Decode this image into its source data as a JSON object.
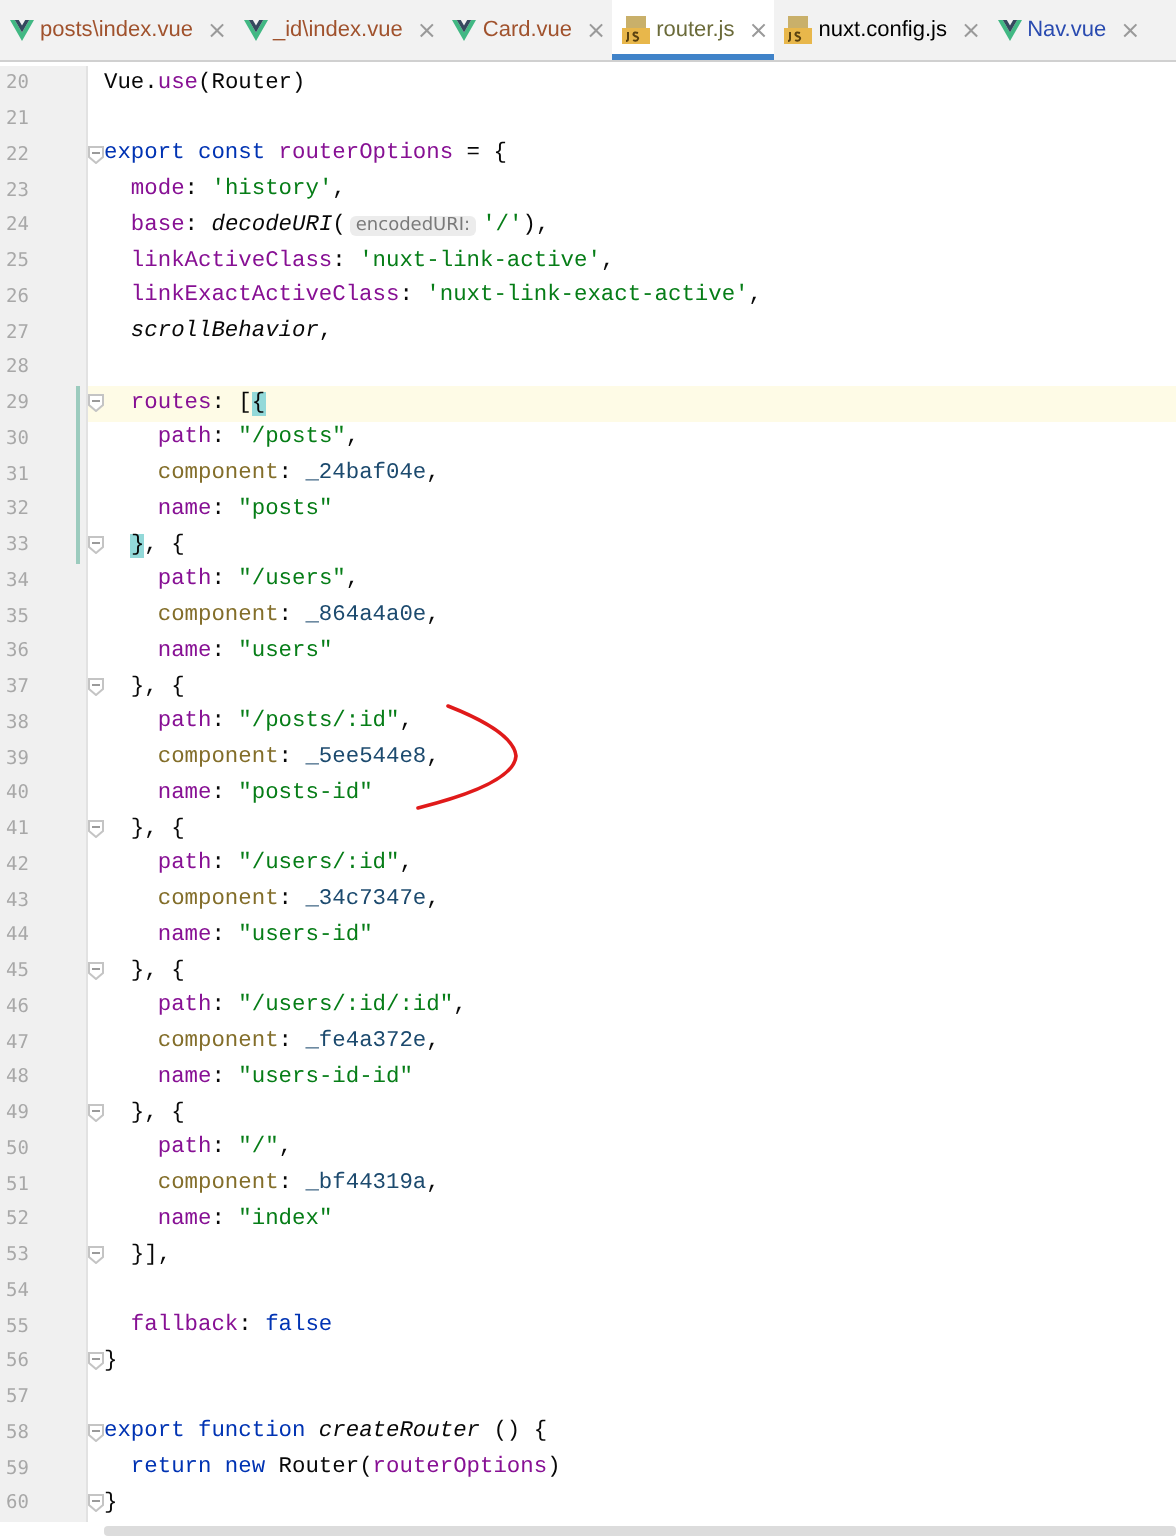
{
  "tabs": [
    {
      "label": "posts\\index.vue",
      "kind": "vue",
      "color": "#a0522d",
      "selected": false,
      "close": "×"
    },
    {
      "label": "_id\\index.vue",
      "kind": "vue",
      "color": "#a0522d",
      "selected": false,
      "close": "×"
    },
    {
      "label": "Card.vue",
      "kind": "vue",
      "color": "#a0522d",
      "selected": false,
      "close": "×"
    },
    {
      "label": "router.js",
      "kind": "js",
      "color": "#6b6b3a",
      "selected": true,
      "close": "×"
    },
    {
      "label": "nuxt.config.js",
      "kind": "js",
      "color": "#000000",
      "selected": false,
      "close": "×"
    },
    {
      "label": "Nav.vue",
      "kind": "vue",
      "color": "#2a4bb0",
      "selected": false,
      "close": "×"
    }
  ],
  "editor": {
    "lines": [
      {
        "number": "20",
        "fold": false,
        "changed": false,
        "current": false,
        "tokens": [
          {
            "text": "Vue.",
            "kind": "plain"
          },
          {
            "text": "use",
            "kind": "prop"
          },
          {
            "text": "(Router)",
            "kind": "plain"
          }
        ]
      },
      {
        "number": "21",
        "fold": false,
        "changed": false,
        "current": false
      },
      {
        "number": "22",
        "fold": true,
        "changed": false,
        "current": false,
        "tokens": [
          {
            "text": "export const",
            "kind": "keyword"
          },
          {
            "text": " routerOptions",
            "kind": "prop"
          },
          {
            "text": " = {",
            "kind": "plain"
          }
        ]
      },
      {
        "number": "23",
        "fold": false,
        "changed": false,
        "current": false,
        "tokens": [
          {
            "text": "  mode",
            "kind": "prop"
          },
          {
            "text": ": ",
            "kind": "plain"
          },
          {
            "text": "'history'",
            "kind": "string"
          },
          {
            "text": ",",
            "kind": "plain"
          }
        ]
      },
      {
        "number": "24",
        "fold": false,
        "changed": false,
        "current": false,
        "tokens": [
          {
            "text": "  base",
            "kind": "prop"
          },
          {
            "text": ": ",
            "kind": "plain"
          },
          {
            "text": "decodeURI",
            "kind": "italic"
          },
          {
            "text": "(",
            "kind": "plain"
          },
          {
            "text": "encodedURI:",
            "kind": "hint"
          },
          {
            "text": "'/'",
            "kind": "string"
          },
          {
            "text": "),",
            "kind": "plain"
          }
        ]
      },
      {
        "number": "25",
        "fold": false,
        "changed": false,
        "current": false,
        "tokens": [
          {
            "text": "  linkActiveClass",
            "kind": "prop"
          },
          {
            "text": ": ",
            "kind": "plain"
          },
          {
            "text": "'nuxt-link-active'",
            "kind": "string"
          },
          {
            "text": ",",
            "kind": "plain"
          }
        ]
      },
      {
        "number": "26",
        "fold": false,
        "changed": false,
        "current": false,
        "tokens": [
          {
            "text": "  linkExactActiveClass",
            "kind": "prop"
          },
          {
            "text": ": ",
            "kind": "plain"
          },
          {
            "text": "'nuxt-link-exact-active'",
            "kind": "string"
          },
          {
            "text": ",",
            "kind": "plain"
          }
        ]
      },
      {
        "number": "27",
        "fold": false,
        "changed": false,
        "current": false,
        "tokens": [
          {
            "text": "  scrollBehavior",
            "kind": "italic"
          },
          {
            "text": ",",
            "kind": "plain"
          }
        ]
      },
      {
        "number": "28",
        "fold": false,
        "changed": false,
        "current": false
      },
      {
        "number": "29",
        "fold": true,
        "changed": true,
        "current": true,
        "tokens": [
          {
            "text": "  routes",
            "kind": "prop"
          },
          {
            "text": ": [",
            "kind": "plain"
          },
          {
            "text": "{",
            "kind": "match"
          }
        ]
      },
      {
        "number": "30",
        "fold": false,
        "changed": true,
        "current": false,
        "tokens": [
          {
            "text": "    path",
            "kind": "prop"
          },
          {
            "text": ": ",
            "kind": "plain"
          },
          {
            "text": "\"/posts\"",
            "kind": "string"
          },
          {
            "text": ",",
            "kind": "plain"
          }
        ]
      },
      {
        "number": "31",
        "fold": false,
        "changed": true,
        "current": false,
        "tokens": [
          {
            "text": "    component",
            "kind": "field"
          },
          {
            "text": ": ",
            "kind": "plain"
          },
          {
            "text": "_24baf04e",
            "kind": "global"
          },
          {
            "text": ",",
            "kind": "plain"
          }
        ]
      },
      {
        "number": "32",
        "fold": false,
        "changed": true,
        "current": false,
        "tokens": [
          {
            "text": "    name",
            "kind": "prop"
          },
          {
            "text": ": ",
            "kind": "plain"
          },
          {
            "text": "\"posts\"",
            "kind": "string"
          }
        ]
      },
      {
        "number": "33",
        "fold": true,
        "changed": true,
        "current": false,
        "tokens": [
          {
            "text": "  }",
            "kind": "match"
          },
          {
            "text": ", {",
            "kind": "plain"
          }
        ]
      },
      {
        "number": "34",
        "fold": false,
        "changed": false,
        "current": false,
        "tokens": [
          {
            "text": "    path",
            "kind": "prop"
          },
          {
            "text": ": ",
            "kind": "plain"
          },
          {
            "text": "\"/users\"",
            "kind": "string"
          },
          {
            "text": ",",
            "kind": "plain"
          }
        ]
      },
      {
        "number": "35",
        "fold": false,
        "changed": false,
        "current": false,
        "tokens": [
          {
            "text": "    component",
            "kind": "field"
          },
          {
            "text": ": ",
            "kind": "plain"
          },
          {
            "text": "_864a4a0e",
            "kind": "global"
          },
          {
            "text": ",",
            "kind": "plain"
          }
        ]
      },
      {
        "number": "36",
        "fold": false,
        "changed": false,
        "current": false,
        "tokens": [
          {
            "text": "    name",
            "kind": "prop"
          },
          {
            "text": ": ",
            "kind": "plain"
          },
          {
            "text": "\"users\"",
            "kind": "string"
          }
        ]
      },
      {
        "number": "37",
        "fold": true,
        "changed": false,
        "current": false,
        "tokens": [
          {
            "text": "  }, {",
            "kind": "plain"
          }
        ]
      },
      {
        "number": "38",
        "fold": false,
        "changed": false,
        "current": false,
        "tokens": [
          {
            "text": "    path",
            "kind": "prop"
          },
          {
            "text": ": ",
            "kind": "plain"
          },
          {
            "text": "\"/posts/:id\"",
            "kind": "string"
          },
          {
            "text": ",",
            "kind": "plain"
          }
        ]
      },
      {
        "number": "39",
        "fold": false,
        "changed": false,
        "current": false,
        "tokens": [
          {
            "text": "    component",
            "kind": "field"
          },
          {
            "text": ": ",
            "kind": "plain"
          },
          {
            "text": "_5ee544e8",
            "kind": "global"
          },
          {
            "text": ",",
            "kind": "plain"
          }
        ]
      },
      {
        "number": "40",
        "fold": false,
        "changed": false,
        "current": false,
        "tokens": [
          {
            "text": "    name",
            "kind": "prop"
          },
          {
            "text": ": ",
            "kind": "plain"
          },
          {
            "text": "\"posts-id\"",
            "kind": "string"
          }
        ]
      },
      {
        "number": "41",
        "fold": true,
        "changed": false,
        "current": false,
        "tokens": [
          {
            "text": "  }, {",
            "kind": "plain"
          }
        ]
      },
      {
        "number": "42",
        "fold": false,
        "changed": false,
        "current": false,
        "tokens": [
          {
            "text": "    path",
            "kind": "prop"
          },
          {
            "text": ": ",
            "kind": "plain"
          },
          {
            "text": "\"/users/:id\"",
            "kind": "string"
          },
          {
            "text": ",",
            "kind": "plain"
          }
        ]
      },
      {
        "number": "43",
        "fold": false,
        "changed": false,
        "current": false,
        "tokens": [
          {
            "text": "    component",
            "kind": "field"
          },
          {
            "text": ": ",
            "kind": "plain"
          },
          {
            "text": "_34c7347e",
            "kind": "global"
          },
          {
            "text": ",",
            "kind": "plain"
          }
        ]
      },
      {
        "number": "44",
        "fold": false,
        "changed": false,
        "current": false,
        "tokens": [
          {
            "text": "    name",
            "kind": "prop"
          },
          {
            "text": ": ",
            "kind": "plain"
          },
          {
            "text": "\"users-id\"",
            "kind": "string"
          }
        ]
      },
      {
        "number": "45",
        "fold": true,
        "changed": false,
        "current": false,
        "tokens": [
          {
            "text": "  }, {",
            "kind": "plain"
          }
        ]
      },
      {
        "number": "46",
        "fold": false,
        "changed": false,
        "current": false,
        "tokens": [
          {
            "text": "    path",
            "kind": "prop"
          },
          {
            "text": ": ",
            "kind": "plain"
          },
          {
            "text": "\"/users/:id/:id\"",
            "kind": "string"
          },
          {
            "text": ",",
            "kind": "plain"
          }
        ]
      },
      {
        "number": "47",
        "fold": false,
        "changed": false,
        "current": false,
        "tokens": [
          {
            "text": "    component",
            "kind": "field"
          },
          {
            "text": ": ",
            "kind": "plain"
          },
          {
            "text": "_fe4a372e",
            "kind": "global"
          },
          {
            "text": ",",
            "kind": "plain"
          }
        ]
      },
      {
        "number": "48",
        "fold": false,
        "changed": false,
        "current": false,
        "tokens": [
          {
            "text": "    name",
            "kind": "prop"
          },
          {
            "text": ": ",
            "kind": "plain"
          },
          {
            "text": "\"users-id-id\"",
            "kind": "string"
          }
        ]
      },
      {
        "number": "49",
        "fold": true,
        "changed": false,
        "current": false,
        "tokens": [
          {
            "text": "  }, {",
            "kind": "plain"
          }
        ]
      },
      {
        "number": "50",
        "fold": false,
        "changed": false,
        "current": false,
        "tokens": [
          {
            "text": "    path",
            "kind": "prop"
          },
          {
            "text": ": ",
            "kind": "plain"
          },
          {
            "text": "\"/\"",
            "kind": "string"
          },
          {
            "text": ",",
            "kind": "plain"
          }
        ]
      },
      {
        "number": "51",
        "fold": false,
        "changed": false,
        "current": false,
        "tokens": [
          {
            "text": "    component",
            "kind": "field"
          },
          {
            "text": ": ",
            "kind": "plain"
          },
          {
            "text": "_bf44319a",
            "kind": "global"
          },
          {
            "text": ",",
            "kind": "plain"
          }
        ]
      },
      {
        "number": "52",
        "fold": false,
        "changed": false,
        "current": false,
        "tokens": [
          {
            "text": "    name",
            "kind": "prop"
          },
          {
            "text": ": ",
            "kind": "plain"
          },
          {
            "text": "\"index\"",
            "kind": "string"
          }
        ]
      },
      {
        "number": "53",
        "fold": true,
        "changed": false,
        "current": false,
        "tokens": [
          {
            "text": "  }],",
            "kind": "plain"
          }
        ]
      },
      {
        "number": "54",
        "fold": false,
        "changed": false,
        "current": false
      },
      {
        "number": "55",
        "fold": false,
        "changed": false,
        "current": false,
        "tokens": [
          {
            "text": "  fallback",
            "kind": "prop"
          },
          {
            "text": ": ",
            "kind": "plain"
          },
          {
            "text": "false",
            "kind": "keyword"
          }
        ]
      },
      {
        "number": "56",
        "fold": true,
        "changed": false,
        "current": false,
        "tokens": [
          {
            "text": "}",
            "kind": "plain"
          }
        ]
      },
      {
        "number": "57",
        "fold": false,
        "changed": false,
        "current": false
      },
      {
        "number": "58",
        "fold": true,
        "changed": false,
        "current": false,
        "tokens": [
          {
            "text": "export function",
            "kind": "keyword"
          },
          {
            "text": " createRouter",
            "kind": "italic"
          },
          {
            "text": " () {",
            "kind": "plain"
          }
        ]
      },
      {
        "number": "59",
        "fold": false,
        "changed": false,
        "current": false,
        "tokens": [
          {
            "text": "  return new",
            "kind": "keyword"
          },
          {
            "text": " Router(",
            "kind": "plain"
          },
          {
            "text": "routerOptions",
            "kind": "prop"
          },
          {
            "text": ")",
            "kind": "plain"
          }
        ]
      },
      {
        "number": "60",
        "fold": true,
        "changed": false,
        "current": false,
        "tokens": [
          {
            "text": "}",
            "kind": "plain"
          }
        ]
      }
    ]
  }
}
